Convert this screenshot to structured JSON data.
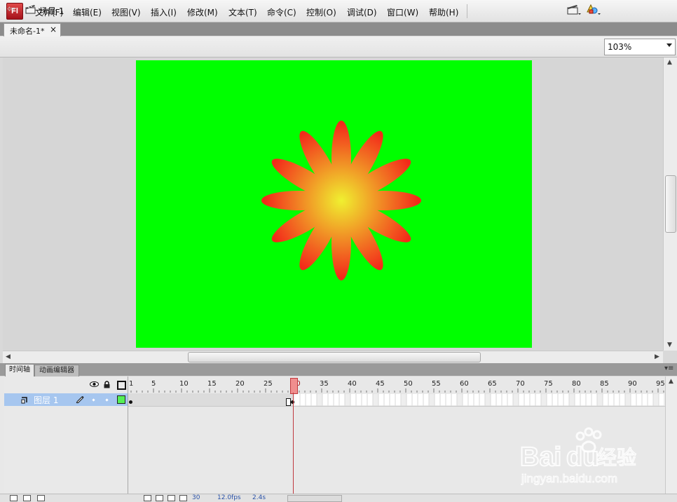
{
  "app": {
    "logo": "Fl"
  },
  "menu": [
    "文件(F)",
    "编辑(E)",
    "视图(V)",
    "插入(I)",
    "修改(M)",
    "文本(T)",
    "命令(C)",
    "控制(O)",
    "调试(D)",
    "窗口(W)",
    "帮助(H)"
  ],
  "document_tab": {
    "title": "未命名-1*",
    "close": "×"
  },
  "edit_bar": {
    "scene_label": "场景 1",
    "zoom": "103%"
  },
  "stage": {
    "background_color": "#00ff00",
    "flower_center_color": "#f0f030",
    "flower_edge_color": "#f22a1a"
  },
  "panel_tabs": {
    "timeline": "时间轴",
    "motion_editor": "动画编辑器"
  },
  "timeline": {
    "ruler": [
      "1",
      "5",
      "10",
      "15",
      "20",
      "25",
      "30",
      "35",
      "40",
      "45",
      "50",
      "55",
      "60",
      "65",
      "70",
      "75",
      "80",
      "85",
      "90",
      "95"
    ],
    "current_frame_marker": "30",
    "layers": [
      {
        "name": "图层 1",
        "color": "#55f055"
      }
    ]
  },
  "status": {
    "frame": "30",
    "fps": "12.0fps",
    "time": "2.4s"
  },
  "watermark": {
    "brand": "Bai",
    "brand2": "du",
    "cn": "经验",
    "url": "jingyan.baidu.com"
  }
}
